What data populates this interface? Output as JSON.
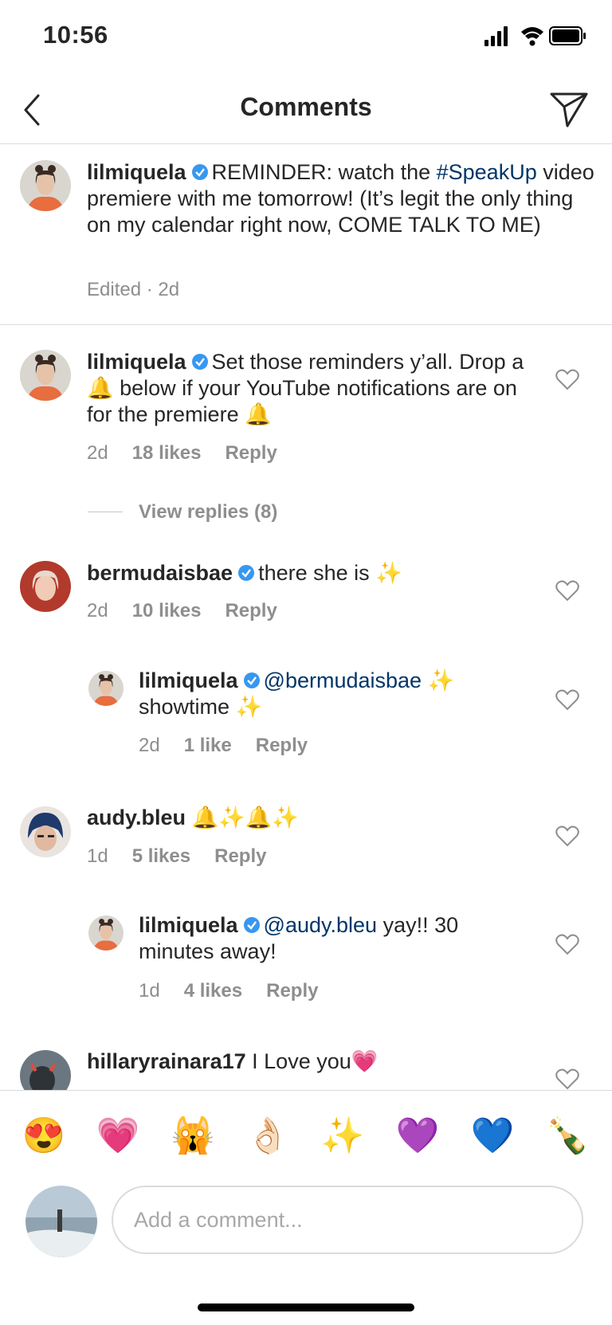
{
  "status_bar": {
    "time": "10:56"
  },
  "header": {
    "title": "Comments"
  },
  "caption": {
    "username": "lilmiquela",
    "text_before": "REMINDER: watch the ",
    "hashtag": "#SpeakUp",
    "text_after": " video premiere with me tomorrow! (It’s legit the only thing on my calendar right now, COME TALK TO ME)",
    "meta": "Edited · 2d"
  },
  "comments": [
    {
      "username": "lilmiquela",
      "text": "Set those reminders y’all. Drop a 🔔 below if your YouTube notifications are on for the premiere 🔔",
      "time": "2d",
      "likes": "18 likes",
      "reply": "Reply",
      "view_replies": "View replies (8)"
    },
    {
      "username": "bermudaisbae",
      "text": "there she is ✨",
      "time": "2d",
      "likes": "10 likes",
      "reply": "Reply",
      "replies": [
        {
          "username": "lilmiquela",
          "mention": "@bermudaisbae",
          "text": " ✨ showtime ✨",
          "time": "2d",
          "likes": "1 like",
          "reply": "Reply"
        }
      ]
    },
    {
      "username": "audy.bleu",
      "text": "🔔✨🔔✨",
      "time": "1d",
      "likes": "5 likes",
      "reply": "Reply",
      "replies": [
        {
          "username": "lilmiquela",
          "mention": "@audy.bleu",
          "text": " yay!! 30 minutes away!",
          "time": "1d",
          "likes": "4 likes",
          "reply": "Reply"
        }
      ]
    },
    {
      "username": "hillaryrainara17",
      "text": "I Love you💗"
    }
  ],
  "emoji_bar": [
    "😍",
    "💗",
    "🙀",
    "👌🏻",
    "✨",
    "💜",
    "💙",
    "🍾"
  ],
  "composer": {
    "placeholder": "Add a comment..."
  },
  "colors": {
    "link": "#003569",
    "verified": "#3897f0",
    "meta": "#8e8e8e",
    "divider": "#dbdbdb"
  }
}
